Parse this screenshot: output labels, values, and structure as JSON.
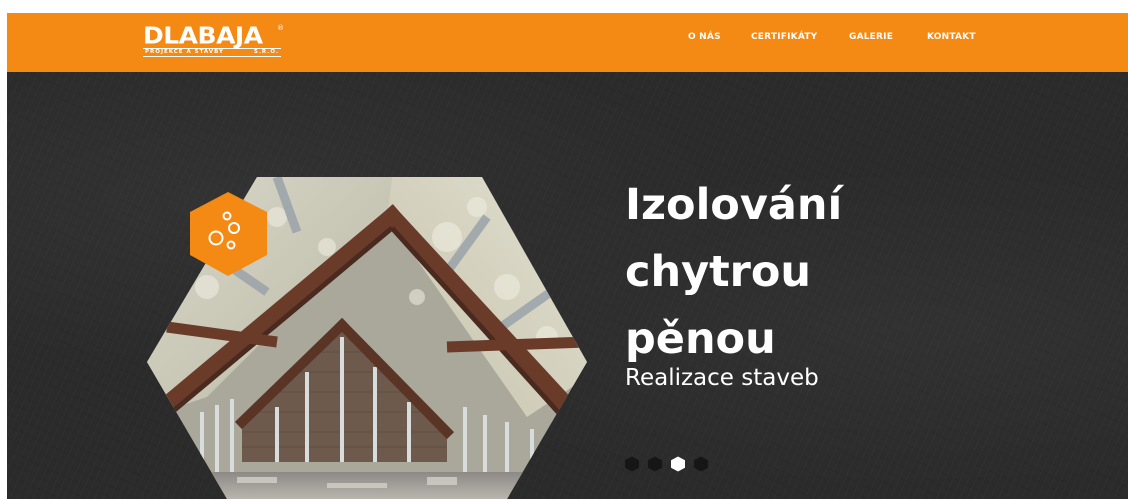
{
  "header": {
    "logo_text": "DLABAJA",
    "logo_registered": "®",
    "logo_tagline": "PROJEKCE A STAVBY",
    "logo_tagline_suffix": "S.R.O.",
    "brand_color": "#f48a14",
    "nav": [
      {
        "label": "O NÁS"
      },
      {
        "label": "CERTIFIKÁTY"
      },
      {
        "label": "GALERIE"
      },
      {
        "label": "KONTAKT"
      }
    ]
  },
  "hero": {
    "title_lines": [
      "Izolování",
      "chytrou",
      "pěnou"
    ],
    "subtitle": "Realizace staveb",
    "badge_icon": "bubbles-icon",
    "slider": {
      "total": 4,
      "active": 3
    }
  }
}
